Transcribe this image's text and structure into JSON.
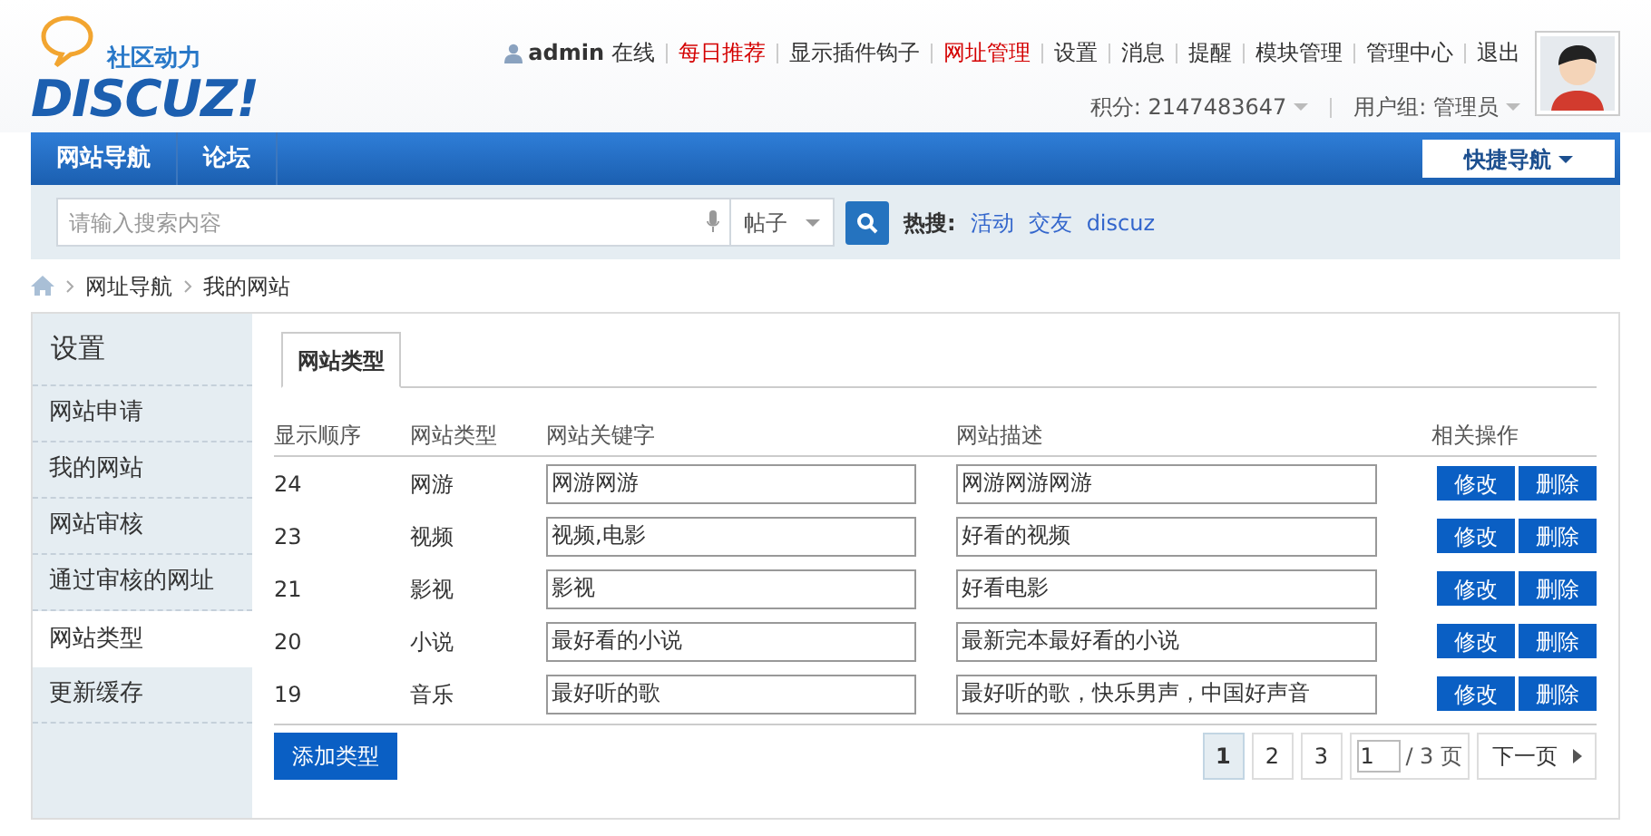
{
  "logo": {
    "tagline": "社区动力",
    "name": "DISCUZ!"
  },
  "user": {
    "name": "admin",
    "status": "在线"
  },
  "top_links": [
    {
      "label": "每日推荐",
      "highlighted": true
    },
    {
      "label": "显示插件钩子",
      "highlighted": false
    },
    {
      "label": "网址管理",
      "highlighted": true
    },
    {
      "label": "设置",
      "highlighted": false
    },
    {
      "label": "消息",
      "highlighted": false
    },
    {
      "label": "提醒",
      "highlighted": false
    },
    {
      "label": "模块管理",
      "highlighted": false
    },
    {
      "label": "管理中心",
      "highlighted": false
    },
    {
      "label": "退出",
      "highlighted": false
    }
  ],
  "points": "积分: 2147483647",
  "usergroup": "用户组: 管理员",
  "nav": {
    "items": [
      "网站导航",
      "论坛"
    ],
    "quick_nav": "快捷导航"
  },
  "search": {
    "placeholder": "请输入搜索内容",
    "type": "帖子",
    "hot_label": "热搜:",
    "hot_items": [
      "活动",
      "交友",
      "discuz"
    ]
  },
  "breadcrumb": [
    "网址导航",
    "我的网站"
  ],
  "sidebar": {
    "title": "设置",
    "items": [
      {
        "label": "网站申请",
        "selected": false
      },
      {
        "label": "我的网站",
        "selected": false
      },
      {
        "label": "网站审核",
        "selected": false
      },
      {
        "label": "通过审核的网址",
        "selected": false
      },
      {
        "label": "网站类型",
        "selected": true
      },
      {
        "label": "更新缓存",
        "selected": false
      }
    ]
  },
  "tabs": [
    {
      "label": "网站类型",
      "selected": true
    }
  ],
  "table": {
    "columns": [
      "显示顺序",
      "网站类型",
      "网站关键字",
      "网站描述",
      "相关操作"
    ],
    "rows": [
      {
        "order": "24",
        "type": "网游",
        "keyword": "网游网游",
        "description": "网游网游网游",
        "actions": [
          "修改",
          "删除"
        ]
      },
      {
        "order": "23",
        "type": "视频",
        "keyword": "视频,电影",
        "description": "好看的视频",
        "actions": [
          "修改",
          "删除"
        ]
      },
      {
        "order": "21",
        "type": "影视",
        "keyword": "影视",
        "description": "好看电影",
        "actions": [
          "修改",
          "删除"
        ]
      },
      {
        "order": "20",
        "type": "小说",
        "keyword": "最好看的小说",
        "description": "最新完本最好看的小说",
        "actions": [
          "修改",
          "删除"
        ]
      },
      {
        "order": "19",
        "type": "音乐",
        "keyword": "最好听的歌",
        "description": "最好听的歌，快乐男声，中国好声音",
        "actions": [
          "修改",
          "删除"
        ]
      }
    ]
  },
  "add_button": "添加类型",
  "pagination": {
    "pages": [
      {
        "label": "1",
        "selected": true
      },
      {
        "label": "2",
        "selected": false
      },
      {
        "label": "3",
        "selected": false
      }
    ],
    "page_input": "1",
    "total": "/ 3 页",
    "next": "下一页"
  }
}
